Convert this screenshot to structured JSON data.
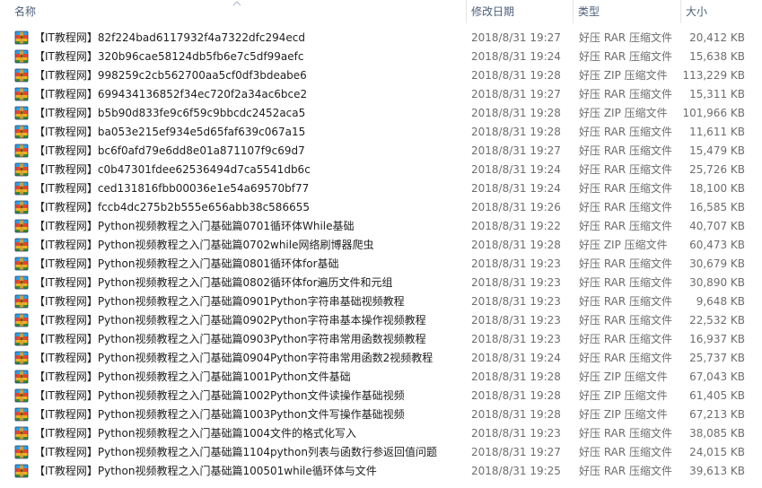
{
  "columns": {
    "name": "名称",
    "date": "修改日期",
    "type": "类型",
    "size": "大小"
  },
  "icon": "archive-file-icon",
  "files": [
    {
      "name": "【IT教程网】82f224bad6117932f4a7322dfc294ecd",
      "date": "2018/8/31 19:27",
      "type": "好压 RAR 压缩文件",
      "size": "20,412 KB"
    },
    {
      "name": "【IT教程网】320b96cae58124db5fb6e7c5df99aefc",
      "date": "2018/8/31 19:24",
      "type": "好压 RAR 压缩文件",
      "size": "15,638 KB"
    },
    {
      "name": "【IT教程网】998259c2cb562700aa5cf0df3bdeabe6",
      "date": "2018/8/31 19:28",
      "type": "好压 ZIP 压缩文件",
      "size": "113,229 KB"
    },
    {
      "name": "【IT教程网】699434136852f34ec720f2a34ac6bce2",
      "date": "2018/8/31 19:27",
      "type": "好压 RAR 压缩文件",
      "size": "15,311 KB"
    },
    {
      "name": "【IT教程网】b5b90d833fe9c6f59c9bbcdc2452aca5",
      "date": "2018/8/31 19:28",
      "type": "好压 ZIP 压缩文件",
      "size": "101,966 KB"
    },
    {
      "name": "【IT教程网】ba053e215ef934e5d65faf639c067a15",
      "date": "2018/8/31 19:28",
      "type": "好压 RAR 压缩文件",
      "size": "11,611 KB"
    },
    {
      "name": "【IT教程网】bc6f0afd79e6dd8e01a871107f9c69d7",
      "date": "2018/8/31 19:27",
      "type": "好压 RAR 压缩文件",
      "size": "15,479 KB"
    },
    {
      "name": "【IT教程网】c0b47301fdee62536494d7ca5541db6c",
      "date": "2018/8/31 19:24",
      "type": "好压 RAR 压缩文件",
      "size": "25,726 KB"
    },
    {
      "name": "【IT教程网】ced131816fbb00036e1e54a69570bf77",
      "date": "2018/8/31 19:24",
      "type": "好压 RAR 压缩文件",
      "size": "18,100 KB"
    },
    {
      "name": "【IT教程网】fccb4dc275b2b555e656abb38c586655",
      "date": "2018/8/31 19:26",
      "type": "好压 RAR 压缩文件",
      "size": "16,585 KB"
    },
    {
      "name": "【IT教程网】Python视频教程之入门基础篇0701循环体While基础",
      "date": "2018/8/31 19:22",
      "type": "好压 RAR 压缩文件",
      "size": "40,707 KB"
    },
    {
      "name": "【IT教程网】Python视频教程之入门基础篇0702while网络刷博器爬虫",
      "date": "2018/8/31 19:28",
      "type": "好压 ZIP 压缩文件",
      "size": "60,473 KB"
    },
    {
      "name": "【IT教程网】Python视频教程之入门基础篇0801循环体for基础",
      "date": "2018/8/31 19:23",
      "type": "好压 RAR 压缩文件",
      "size": "30,679 KB"
    },
    {
      "name": "【IT教程网】Python视频教程之入门基础篇0802循环体for遍历文件和元组",
      "date": "2018/8/31 19:23",
      "type": "好压 RAR 压缩文件",
      "size": "30,890 KB"
    },
    {
      "name": "【IT教程网】Python视频教程之入门基础篇0901Python字符串基础视频教程",
      "date": "2018/8/31 19:23",
      "type": "好压 RAR 压缩文件",
      "size": "9,648 KB"
    },
    {
      "name": "【IT教程网】Python视频教程之入门基础篇0902Python字符串基本操作视频教程",
      "date": "2018/8/31 19:23",
      "type": "好压 RAR 压缩文件",
      "size": "22,532 KB"
    },
    {
      "name": "【IT教程网】Python视频教程之入门基础篇0903Python字符串常用函数视频教程",
      "date": "2018/8/31 19:23",
      "type": "好压 RAR 压缩文件",
      "size": "16,937 KB"
    },
    {
      "name": "【IT教程网】Python视频教程之入门基础篇0904Python字符串常用函数2视频教程",
      "date": "2018/8/31 19:24",
      "type": "好压 RAR 压缩文件",
      "size": "25,737 KB"
    },
    {
      "name": "【IT教程网】Python视频教程之入门基础篇1001Python文件基础",
      "date": "2018/8/31 19:28",
      "type": "好压 ZIP 压缩文件",
      "size": "67,043 KB"
    },
    {
      "name": "【IT教程网】Python视频教程之入门基础篇1002Python文件读操作基础视频",
      "date": "2018/8/31 19:28",
      "type": "好压 ZIP 压缩文件",
      "size": "61,405 KB"
    },
    {
      "name": "【IT教程网】Python视频教程之入门基础篇1003Python文件写操作基础视频",
      "date": "2018/8/31 19:28",
      "type": "好压 ZIP 压缩文件",
      "size": "67,213 KB"
    },
    {
      "name": "【IT教程网】Python视频教程之入门基础篇1004文件的格式化写入",
      "date": "2018/8/31 19:23",
      "type": "好压 RAR 压缩文件",
      "size": "38,085 KB"
    },
    {
      "name": "【IT教程网】Python视频教程之入门基础篇1104python列表与函数行参返回值问题",
      "date": "2018/8/31 19:27",
      "type": "好压 RAR 压缩文件",
      "size": "24,015 KB"
    },
    {
      "name": "【IT教程网】Python视频教程之入门基础篇100501while循环体与文件",
      "date": "2018/8/31 19:25",
      "type": "好压 RAR 压缩文件",
      "size": "39,613 KB"
    }
  ]
}
